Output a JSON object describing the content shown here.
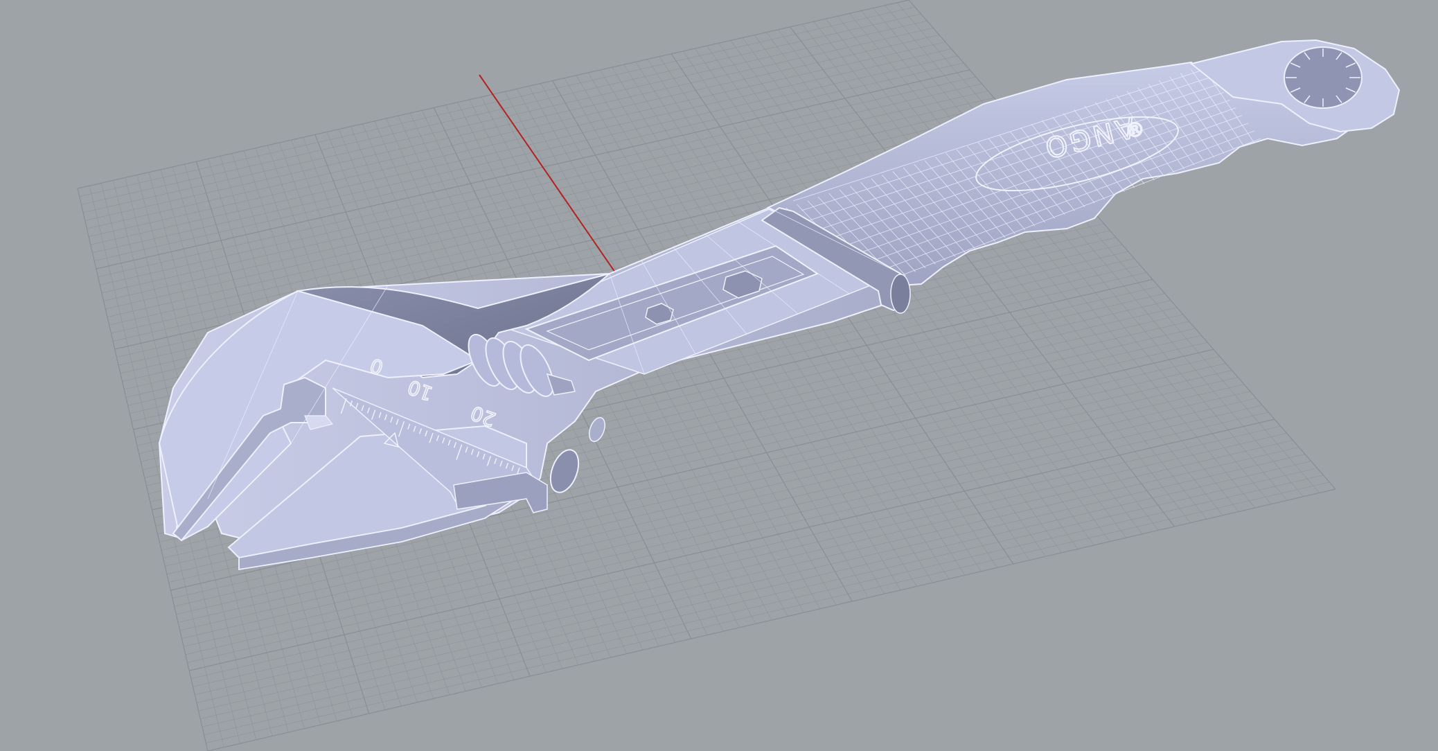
{
  "viewport": {
    "view": "perspective",
    "background": "#9ea3a8",
    "grid_color": "#878c92",
    "x_axis_color": "#b22222",
    "y_axis_color": "#1f9a1f",
    "model_fill": "#b4b9d6",
    "model_shade": "#8b90ad",
    "wire_color": "#e9ecff"
  },
  "model": {
    "name": "adjustable-wrench",
    "scale_labels": [
      "0",
      "10",
      "20"
    ],
    "brand_text": "ANGO",
    "brand_mark": "®"
  }
}
